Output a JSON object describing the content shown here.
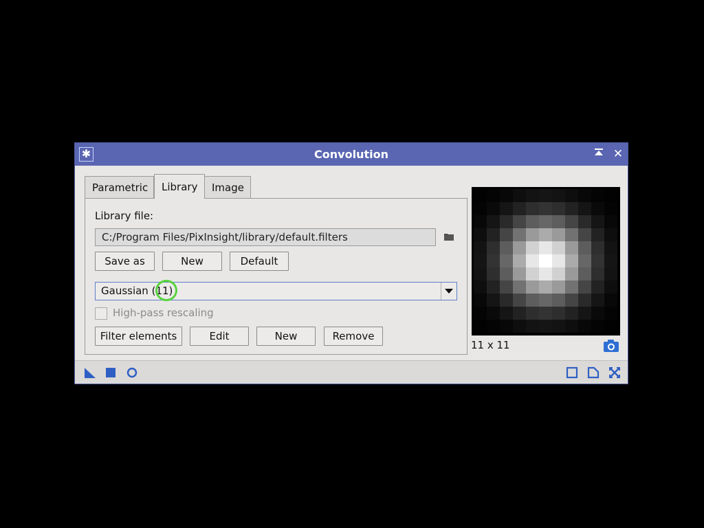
{
  "window": {
    "title": "Convolution",
    "icons": {
      "app": "process-icon",
      "shade": "shade-icon",
      "close": "close-icon"
    }
  },
  "tabs": [
    {
      "label": "Parametric",
      "active": false
    },
    {
      "label": "Library",
      "active": true
    },
    {
      "label": "Image",
      "active": false
    }
  ],
  "library": {
    "file_label": "Library file:",
    "file_path": "C:/Program Files/PixInsight/library/default.filters",
    "buttons": {
      "save_as": "Save as",
      "new": "New",
      "default": "Default"
    },
    "filter": {
      "selected": "Gaussian (11)"
    },
    "high_pass": {
      "label": "High-pass rescaling",
      "checked": false,
      "enabled": false
    },
    "filter_buttons": {
      "filter_elements": "Filter elements",
      "edit": "Edit",
      "new": "New",
      "remove": "Remove"
    }
  },
  "preview": {
    "size_label": "11 x 11",
    "kernel_size": 11
  },
  "statusbar": {
    "left_icons": [
      "new-instance-icon",
      "apply-global-icon",
      "apply-icon"
    ],
    "right_icons": [
      "preview-icon",
      "reset-icon",
      "collapse-icon"
    ]
  },
  "colors": {
    "titlebar": "#5a66b2",
    "accent": "#3b6fd0",
    "highlight": "#57d33c"
  }
}
